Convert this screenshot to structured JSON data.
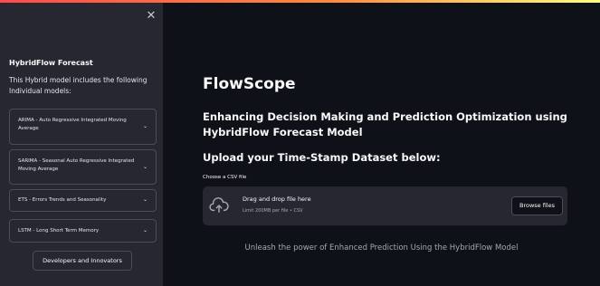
{
  "sidebar": {
    "close_icon": "✕",
    "title": "HybridFlow Forecast",
    "description": "This Hybrid model includes the following Individual models:",
    "expanders": [
      {
        "label": "ARIMA - Auto Regressive Integrated Moving Average"
      },
      {
        "label": "SARIMA - Seasonal Auto Regressive Integrated Moving Average"
      },
      {
        "label": "ETS - Errors Trends and Seasonality"
      },
      {
        "label": "LSTM - Long Short Term Memory"
      }
    ],
    "chevron": "⌄",
    "developers_button": "Developers and Innovators"
  },
  "main": {
    "title": "FlowScope",
    "subtitle": "Enhancing Decision Making and Prediction Optimization using HybridFlow Forecast Model",
    "upload_heading": "Upload your Time-Stamp Dataset below:",
    "uploader": {
      "label": "Choose a CSV file",
      "drag_text": "Drag and drop file here",
      "limit_text": "Limit 200MB per file • CSV",
      "browse_label": "Browse files"
    },
    "tagline": "Unleash the power of Enhanced Prediction Using the HybridFlow Model"
  },
  "colors": {
    "background": "#0e1117",
    "sidebar": "#262730",
    "accent_gradient": [
      "#ff4b4b",
      "#ff8a3d",
      "#fffd80"
    ]
  },
  "icons": {
    "close": "close-icon",
    "chevron": "chevron-down-icon",
    "upload": "cloud-upload-icon"
  }
}
